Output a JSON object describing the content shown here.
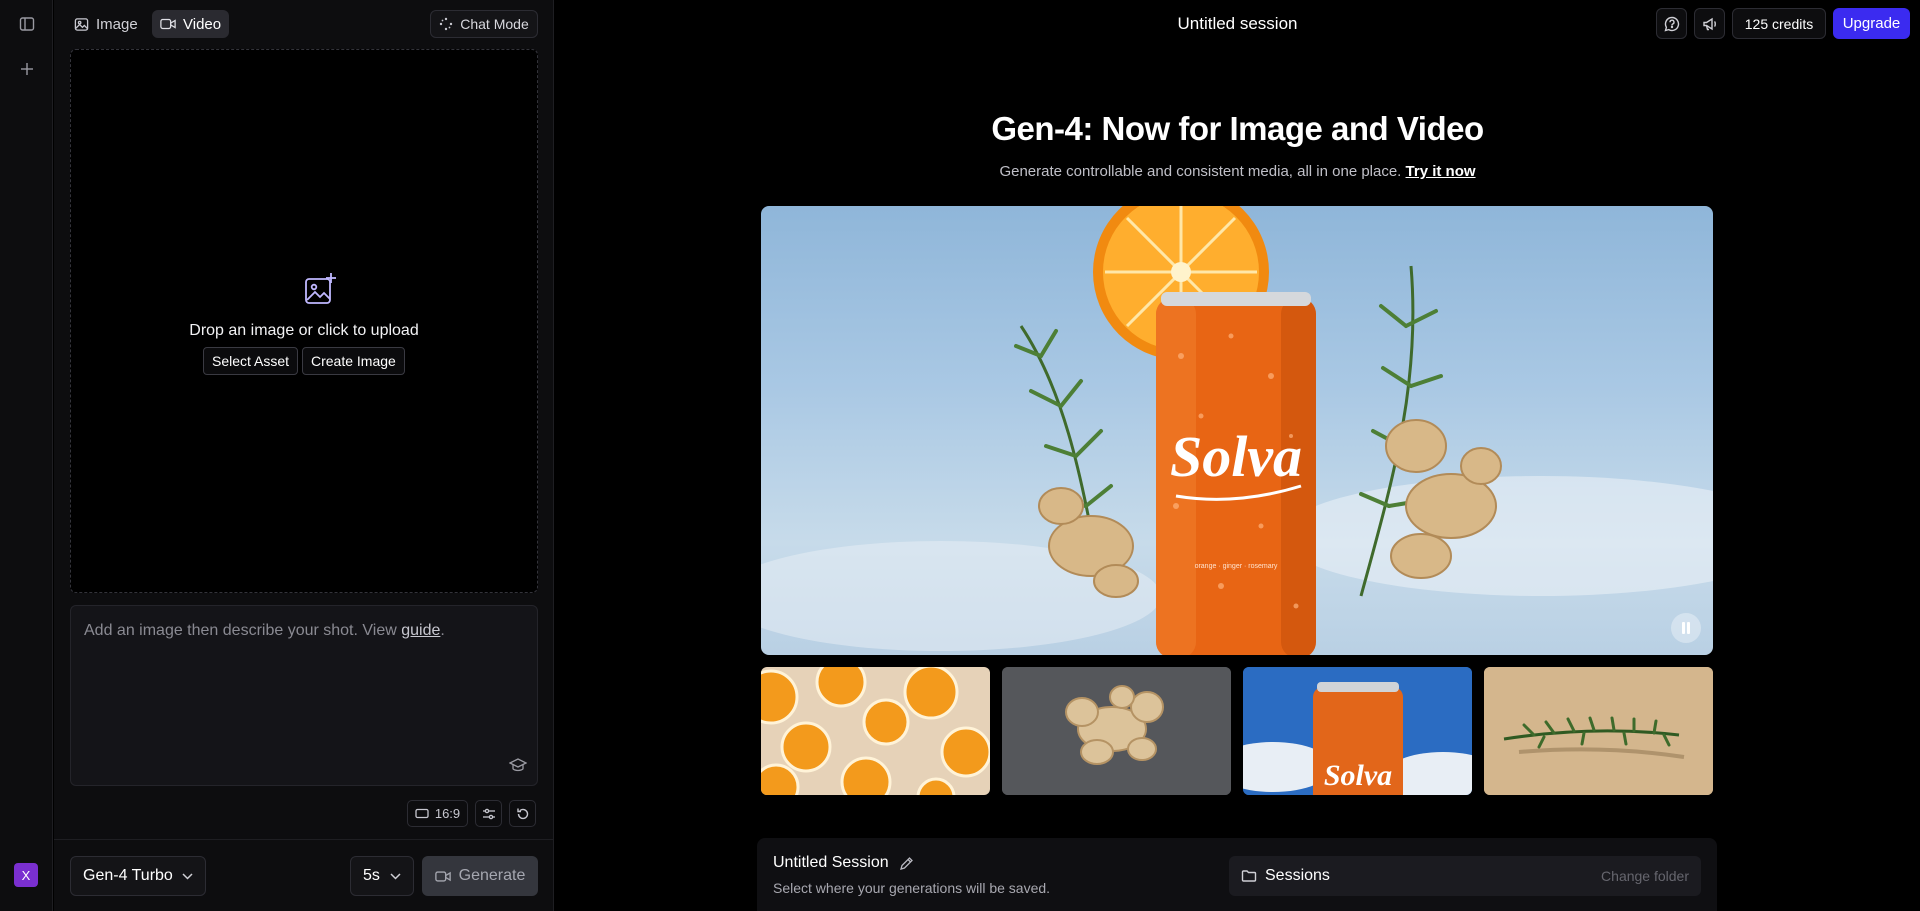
{
  "rail": {
    "avatar_letter": "X"
  },
  "panel": {
    "tabs": [
      {
        "label": "Image",
        "icon": "image-icon"
      },
      {
        "label": "Video",
        "icon": "video-icon",
        "active": true
      }
    ],
    "chat_mode_label": "Chat Mode",
    "dropzone": {
      "title": "Drop an image or click to upload",
      "select_asset": "Select Asset",
      "create_image": "Create Image"
    },
    "prompt": {
      "placeholder_prefix": "Add an image then describe your shot. View ",
      "guide_link": "guide",
      "placeholder_suffix": "."
    },
    "aspect_ratio": "16:9",
    "model": "Gen-4 Turbo",
    "duration": "5s",
    "generate_label": "Generate"
  },
  "header": {
    "session_title": "Untitled session",
    "credits": "125 credits",
    "upgrade": "Upgrade"
  },
  "hero": {
    "title": "Gen-4: Now for Image and Video",
    "subtitle": "Generate controllable and consistent media, all in one place. ",
    "try_link": "Try it now",
    "brand_on_can": "Solva",
    "can_tagline": "orange · ginger · rosemary"
  },
  "thumbnails": [
    {
      "name": "orange-slices-thumbnail"
    },
    {
      "name": "ginger-root-thumbnail"
    },
    {
      "name": "solva-can-thumbnail",
      "brand": "Solva"
    },
    {
      "name": "rosemary-sprig-thumbnail"
    }
  ],
  "session_bar": {
    "title": "Untitled Session",
    "subtitle": "Select where your generations will be saved.",
    "folder": "Sessions",
    "change_folder": "Change folder"
  },
  "colors": {
    "accent": "#3b2bf0",
    "avatar": "#7a2fd0",
    "background": "#000000",
    "panel": "#0d0d0f"
  }
}
